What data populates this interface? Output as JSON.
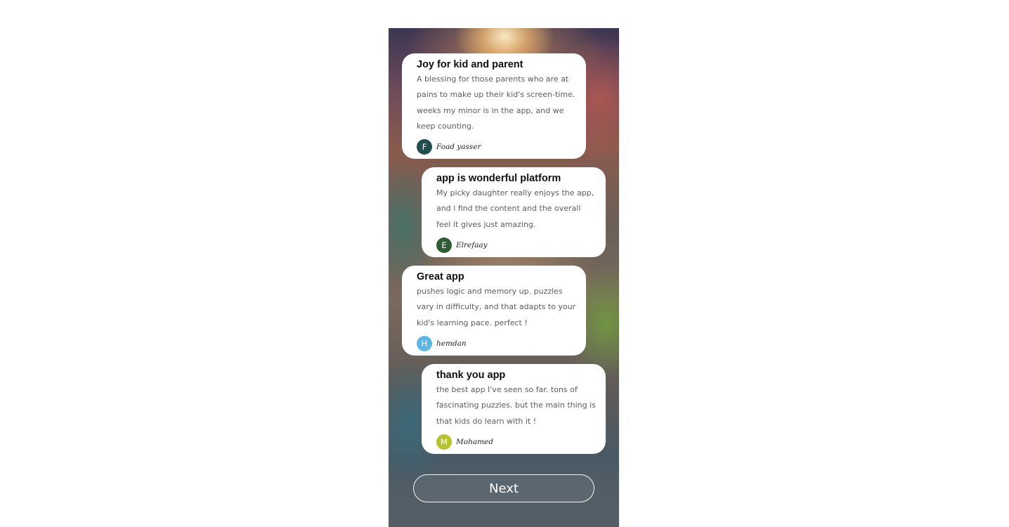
{
  "reviews": [
    {
      "title": "Joy for kid and parent",
      "body": "A blessing for those parents who are at pains to make up their kid's screen-time. weeks my minor is in the app, and we keep counting.",
      "author": "Foad yasser",
      "initial": "F",
      "avatar_color": "#1f4e4e"
    },
    {
      "title": "app is wonderful platform",
      "body": "My picky daughter really enjoys the app, and i find the content and the overall feel it gives just amazing.",
      "author": "Elrefaay",
      "initial": "E",
      "avatar_color": "#2e5e32"
    },
    {
      "title": "Great app",
      "body": "pushes logic and memory up. puzzles vary in difficulty, and that adapts to your kid's learning pace. perfect !",
      "author": "hemdan",
      "initial": "H",
      "avatar_color": "#5bb8e6"
    },
    {
      "title": "thank you app",
      "body": "the best app I've seen so far. tons of fascinating puzzles. but the main thing is that kids do learn with it !",
      "author": "Mohamed",
      "initial": "M",
      "avatar_color": "#b5c42a"
    }
  ],
  "next_button": {
    "label": "Next"
  }
}
